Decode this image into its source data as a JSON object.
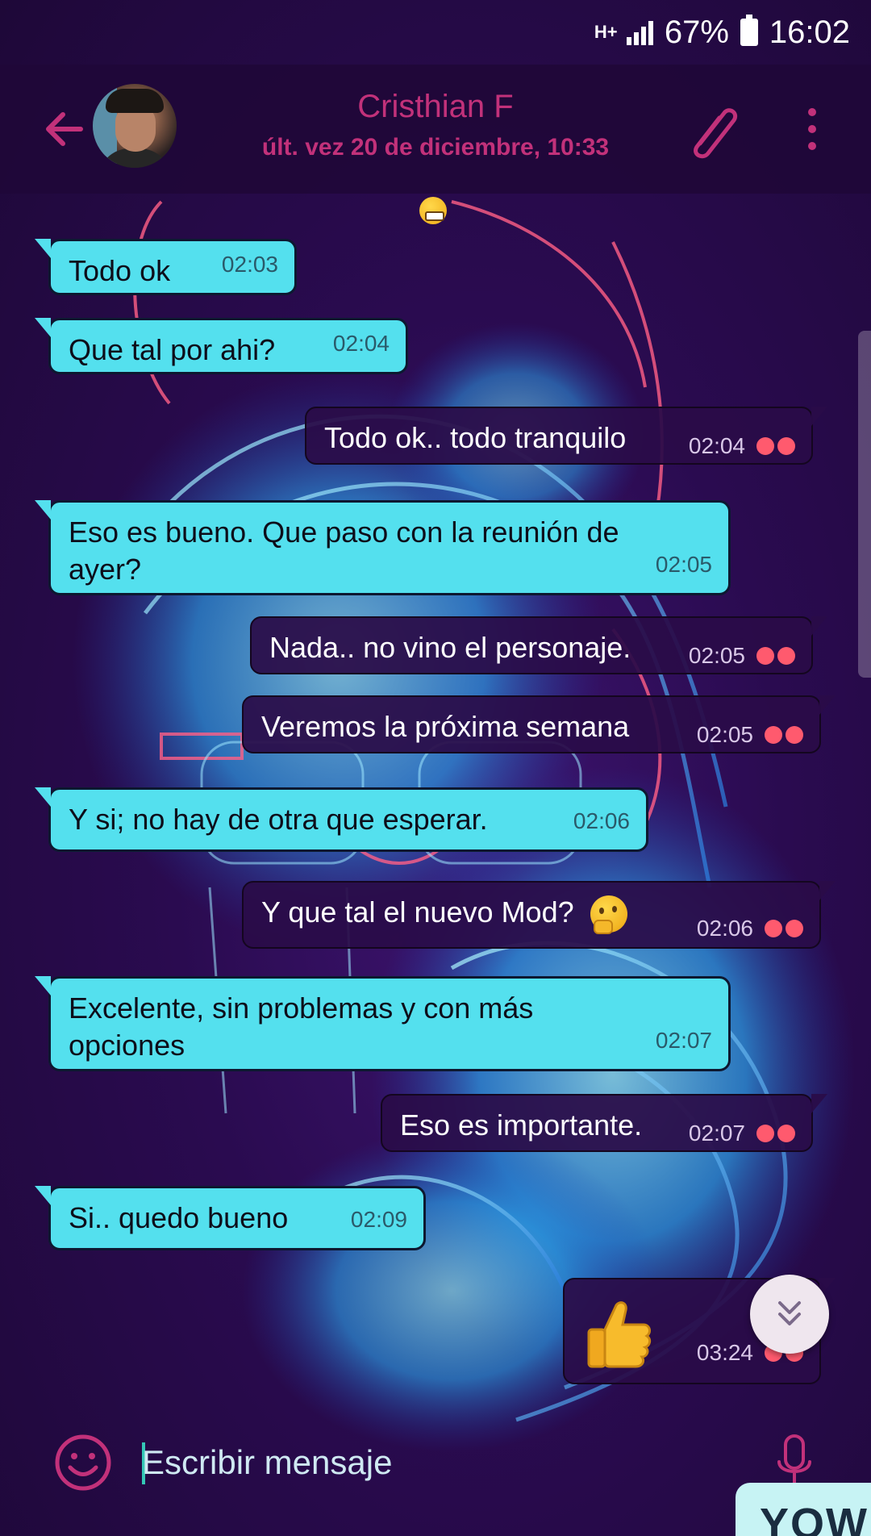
{
  "status_bar": {
    "network": "H+",
    "battery": "67%",
    "time": "16:02"
  },
  "header": {
    "contact_name": "Cristhian F",
    "last_seen": "últ. vez 20 de diciembre, 10:33"
  },
  "messages": [
    {
      "direction": "in",
      "text": "Todo ok",
      "time": "02:03"
    },
    {
      "direction": "in",
      "text": "Que tal por ahi?",
      "time": "02:04"
    },
    {
      "direction": "out",
      "text": "Todo ok.. todo tranquilo",
      "time": "02:04"
    },
    {
      "direction": "in",
      "text": "Eso es bueno. Que paso con la reunión de ayer?",
      "time": "02:05"
    },
    {
      "direction": "out",
      "text": "Nada.. no vino el personaje.",
      "time": "02:05"
    },
    {
      "direction": "out",
      "text": "Veremos la próxima semana",
      "time": "02:05"
    },
    {
      "direction": "in",
      "text": "Y si; no hay de otra que esperar.",
      "time": "02:06"
    },
    {
      "direction": "out",
      "text": "Y que tal el nuevo Mod?",
      "emoji": "thinking-face",
      "time": "02:06"
    },
    {
      "direction": "in",
      "text": "Excelente, sin problemas y con más opciones",
      "time": "02:07"
    },
    {
      "direction": "out",
      "text": "Eso es importante.",
      "time": "02:07"
    },
    {
      "direction": "in",
      "text": "Si.. quedo bueno",
      "time": "02:09"
    },
    {
      "direction": "out",
      "emoji": "thumbs-up",
      "time": "03:24"
    }
  ],
  "input": {
    "placeholder": "Escribir mensaje"
  },
  "sticker_peek": "YOW",
  "colors": {
    "accent": "#c2317a",
    "incoming_bubble": "#54e0ee",
    "outgoing_bubble": "#2a0c48",
    "read_ticks": "#ff5a6e"
  },
  "icons": [
    "back-arrow-icon",
    "paperclip-icon",
    "more-vert-icon",
    "smiley-icon",
    "microphone-icon",
    "chevron-double-down-icon"
  ]
}
